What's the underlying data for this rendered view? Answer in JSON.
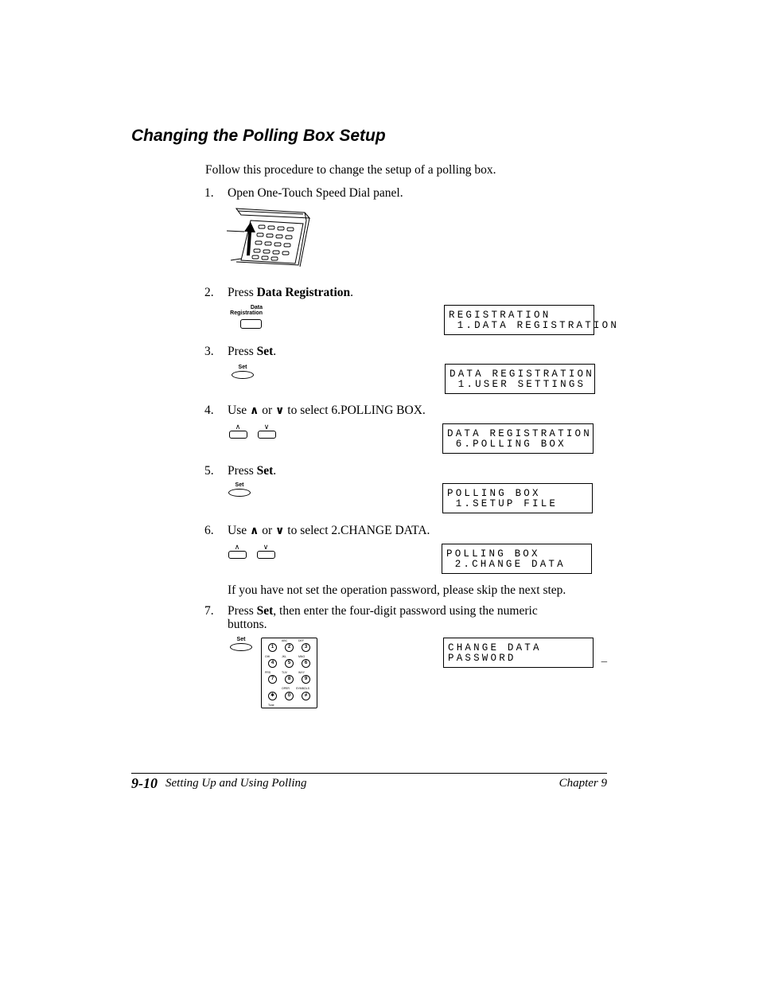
{
  "section_title": "Changing the Polling Box Setup",
  "intro": "Follow this procedure to change the setup of a polling box.",
  "steps": [
    {
      "num": "1.",
      "pre": "Open One-Touch Speed Dial panel.",
      "bold": "",
      "post": ""
    },
    {
      "num": "2.",
      "pre": "Press ",
      "bold": "Data Registration",
      "post": "."
    },
    {
      "num": "3.",
      "pre": "Press ",
      "bold": "Set",
      "post": "."
    },
    {
      "num": "4.",
      "pre": "Use ",
      "up": "∧",
      "mid": " or ",
      "down": "∨",
      "post": " to select 6.POLLING BOX."
    },
    {
      "num": "5.",
      "pre": "Press ",
      "bold": "Set",
      "post": "."
    },
    {
      "num": "6.",
      "pre": "Use ",
      "up": "∧",
      "mid": " or ",
      "down": "∨",
      "post": " to select 2.CHANGE DATA."
    },
    {
      "num": "7.",
      "pre": "Press ",
      "bold": "Set",
      "post": ", then enter the four-digit password using the numeric",
      "line2": "buttons."
    }
  ],
  "note": "If you have not set the operation password, please skip the next step.",
  "buttons": {
    "data_registration_line1": "Data",
    "data_registration_line2": "Registration",
    "set": "Set",
    "up": "∧",
    "down": "∨"
  },
  "lcd_displays": [
    {
      "line1": "REGISTRATION",
      "line2": " 1.DATA REGISTRATION"
    },
    {
      "line1": "DATA REGISTRATION",
      "line2": " 1.USER SETTINGS"
    },
    {
      "line1": "DATA REGISTRATION",
      "line2": " 6.POLLING BOX"
    },
    {
      "line1": "POLLING BOX",
      "line2": " 1.SETUP FILE"
    },
    {
      "line1": "POLLING BOX",
      "line2": " 2.CHANGE DATA"
    },
    {
      "line1": "CHANGE DATA",
      "line2": "PASSWORD          _"
    }
  ],
  "keypad": {
    "keys": [
      "1",
      "2",
      "3",
      "4",
      "5",
      "6",
      "7",
      "8",
      "9",
      "✱",
      "0",
      "#"
    ],
    "letters": [
      "",
      "ABC",
      "DEF",
      "GHI",
      "JKL",
      "MNO",
      "PRS",
      "TUV",
      "WXY",
      "",
      "OPER",
      "SYMBOLS"
    ],
    "bottom_label": "Tone"
  },
  "footer": {
    "page_number": "9-10",
    "section": "Setting Up and Using Polling",
    "chapter": "Chapter 9"
  }
}
